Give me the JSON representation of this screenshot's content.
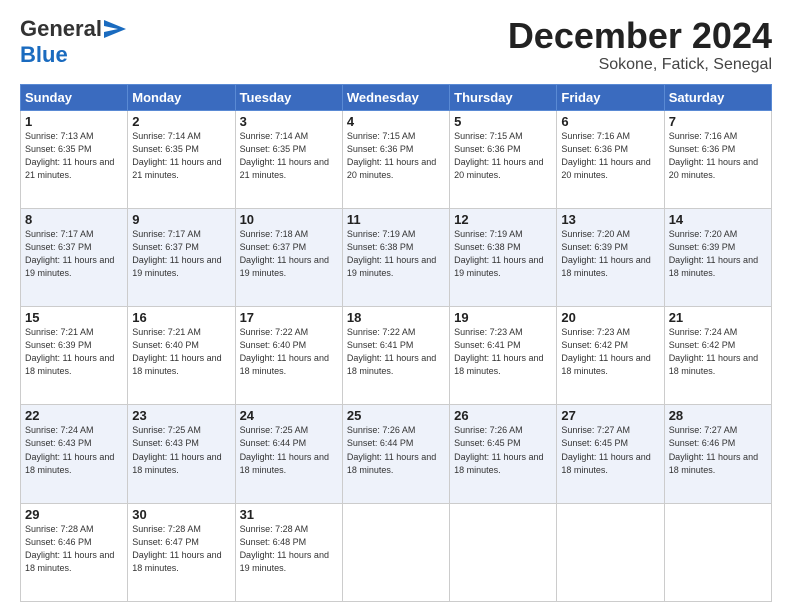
{
  "header": {
    "logo_general": "General",
    "logo_blue": "Blue",
    "month_title": "December 2024",
    "location": "Sokone, Fatick, Senegal"
  },
  "days_of_week": [
    "Sunday",
    "Monday",
    "Tuesday",
    "Wednesday",
    "Thursday",
    "Friday",
    "Saturday"
  ],
  "weeks": [
    [
      {
        "day": "1",
        "sunrise": "Sunrise: 7:13 AM",
        "sunset": "Sunset: 6:35 PM",
        "daylight": "Daylight: 11 hours and 21 minutes."
      },
      {
        "day": "2",
        "sunrise": "Sunrise: 7:14 AM",
        "sunset": "Sunset: 6:35 PM",
        "daylight": "Daylight: 11 hours and 21 minutes."
      },
      {
        "day": "3",
        "sunrise": "Sunrise: 7:14 AM",
        "sunset": "Sunset: 6:35 PM",
        "daylight": "Daylight: 11 hours and 21 minutes."
      },
      {
        "day": "4",
        "sunrise": "Sunrise: 7:15 AM",
        "sunset": "Sunset: 6:36 PM",
        "daylight": "Daylight: 11 hours and 20 minutes."
      },
      {
        "day": "5",
        "sunrise": "Sunrise: 7:15 AM",
        "sunset": "Sunset: 6:36 PM",
        "daylight": "Daylight: 11 hours and 20 minutes."
      },
      {
        "day": "6",
        "sunrise": "Sunrise: 7:16 AM",
        "sunset": "Sunset: 6:36 PM",
        "daylight": "Daylight: 11 hours and 20 minutes."
      },
      {
        "day": "7",
        "sunrise": "Sunrise: 7:16 AM",
        "sunset": "Sunset: 6:36 PM",
        "daylight": "Daylight: 11 hours and 20 minutes."
      }
    ],
    [
      {
        "day": "8",
        "sunrise": "Sunrise: 7:17 AM",
        "sunset": "Sunset: 6:37 PM",
        "daylight": "Daylight: 11 hours and 19 minutes."
      },
      {
        "day": "9",
        "sunrise": "Sunrise: 7:17 AM",
        "sunset": "Sunset: 6:37 PM",
        "daylight": "Daylight: 11 hours and 19 minutes."
      },
      {
        "day": "10",
        "sunrise": "Sunrise: 7:18 AM",
        "sunset": "Sunset: 6:37 PM",
        "daylight": "Daylight: 11 hours and 19 minutes."
      },
      {
        "day": "11",
        "sunrise": "Sunrise: 7:19 AM",
        "sunset": "Sunset: 6:38 PM",
        "daylight": "Daylight: 11 hours and 19 minutes."
      },
      {
        "day": "12",
        "sunrise": "Sunrise: 7:19 AM",
        "sunset": "Sunset: 6:38 PM",
        "daylight": "Daylight: 11 hours and 19 minutes."
      },
      {
        "day": "13",
        "sunrise": "Sunrise: 7:20 AM",
        "sunset": "Sunset: 6:39 PM",
        "daylight": "Daylight: 11 hours and 18 minutes."
      },
      {
        "day": "14",
        "sunrise": "Sunrise: 7:20 AM",
        "sunset": "Sunset: 6:39 PM",
        "daylight": "Daylight: 11 hours and 18 minutes."
      }
    ],
    [
      {
        "day": "15",
        "sunrise": "Sunrise: 7:21 AM",
        "sunset": "Sunset: 6:39 PM",
        "daylight": "Daylight: 11 hours and 18 minutes."
      },
      {
        "day": "16",
        "sunrise": "Sunrise: 7:21 AM",
        "sunset": "Sunset: 6:40 PM",
        "daylight": "Daylight: 11 hours and 18 minutes."
      },
      {
        "day": "17",
        "sunrise": "Sunrise: 7:22 AM",
        "sunset": "Sunset: 6:40 PM",
        "daylight": "Daylight: 11 hours and 18 minutes."
      },
      {
        "day": "18",
        "sunrise": "Sunrise: 7:22 AM",
        "sunset": "Sunset: 6:41 PM",
        "daylight": "Daylight: 11 hours and 18 minutes."
      },
      {
        "day": "19",
        "sunrise": "Sunrise: 7:23 AM",
        "sunset": "Sunset: 6:41 PM",
        "daylight": "Daylight: 11 hours and 18 minutes."
      },
      {
        "day": "20",
        "sunrise": "Sunrise: 7:23 AM",
        "sunset": "Sunset: 6:42 PM",
        "daylight": "Daylight: 11 hours and 18 minutes."
      },
      {
        "day": "21",
        "sunrise": "Sunrise: 7:24 AM",
        "sunset": "Sunset: 6:42 PM",
        "daylight": "Daylight: 11 hours and 18 minutes."
      }
    ],
    [
      {
        "day": "22",
        "sunrise": "Sunrise: 7:24 AM",
        "sunset": "Sunset: 6:43 PM",
        "daylight": "Daylight: 11 hours and 18 minutes."
      },
      {
        "day": "23",
        "sunrise": "Sunrise: 7:25 AM",
        "sunset": "Sunset: 6:43 PM",
        "daylight": "Daylight: 11 hours and 18 minutes."
      },
      {
        "day": "24",
        "sunrise": "Sunrise: 7:25 AM",
        "sunset": "Sunset: 6:44 PM",
        "daylight": "Daylight: 11 hours and 18 minutes."
      },
      {
        "day": "25",
        "sunrise": "Sunrise: 7:26 AM",
        "sunset": "Sunset: 6:44 PM",
        "daylight": "Daylight: 11 hours and 18 minutes."
      },
      {
        "day": "26",
        "sunrise": "Sunrise: 7:26 AM",
        "sunset": "Sunset: 6:45 PM",
        "daylight": "Daylight: 11 hours and 18 minutes."
      },
      {
        "day": "27",
        "sunrise": "Sunrise: 7:27 AM",
        "sunset": "Sunset: 6:45 PM",
        "daylight": "Daylight: 11 hours and 18 minutes."
      },
      {
        "day": "28",
        "sunrise": "Sunrise: 7:27 AM",
        "sunset": "Sunset: 6:46 PM",
        "daylight": "Daylight: 11 hours and 18 minutes."
      }
    ],
    [
      {
        "day": "29",
        "sunrise": "Sunrise: 7:28 AM",
        "sunset": "Sunset: 6:46 PM",
        "daylight": "Daylight: 11 hours and 18 minutes."
      },
      {
        "day": "30",
        "sunrise": "Sunrise: 7:28 AM",
        "sunset": "Sunset: 6:47 PM",
        "daylight": "Daylight: 11 hours and 18 minutes."
      },
      {
        "day": "31",
        "sunrise": "Sunrise: 7:28 AM",
        "sunset": "Sunset: 6:48 PM",
        "daylight": "Daylight: 11 hours and 19 minutes."
      },
      null,
      null,
      null,
      null
    ]
  ]
}
